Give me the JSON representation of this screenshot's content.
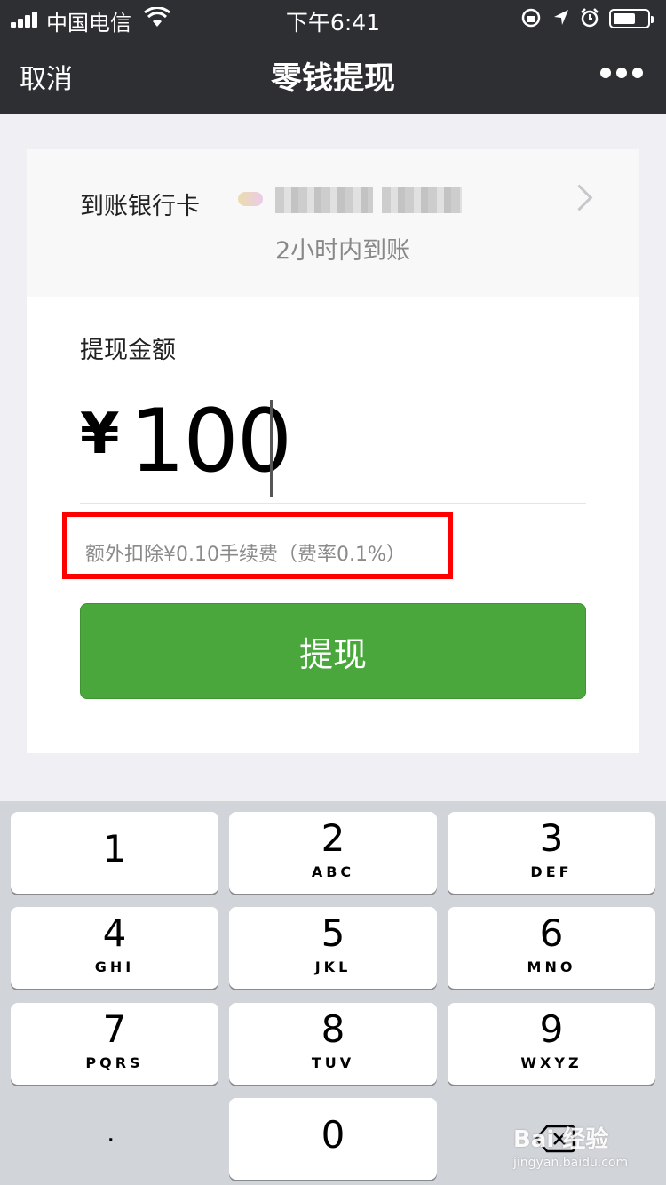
{
  "status_bar": {
    "carrier": "中国电信",
    "time": "下午6:41"
  },
  "nav": {
    "cancel_label": "取消",
    "title": "零钱提现",
    "more_icon": "more-dots-icon"
  },
  "bank": {
    "label": "到账银行卡",
    "arrival": "2小时内到账"
  },
  "amount": {
    "label": "提现金额",
    "currency": "¥",
    "value": "100"
  },
  "fee_note": "额外扣除¥0.10手续费（费率0.1%）",
  "withdraw_button": "提现",
  "keypad": {
    "keys": [
      {
        "num": "1",
        "letters": ""
      },
      {
        "num": "2",
        "letters": "ABC"
      },
      {
        "num": "3",
        "letters": "DEF"
      },
      {
        "num": "4",
        "letters": "GHI"
      },
      {
        "num": "5",
        "letters": "JKL"
      },
      {
        "num": "6",
        "letters": "MNO"
      },
      {
        "num": "7",
        "letters": "PQRS"
      },
      {
        "num": "8",
        "letters": "TUV"
      },
      {
        "num": "9",
        "letters": "WXYZ"
      }
    ],
    "zero": "0",
    "dot": "."
  },
  "watermark": {
    "line1": "Bai 经验",
    "line2": "jingyan.baidu.com"
  },
  "colors": {
    "nav_bg": "#2e2f33",
    "button_green": "#4aa73b",
    "highlight_red": "#ff0000"
  }
}
